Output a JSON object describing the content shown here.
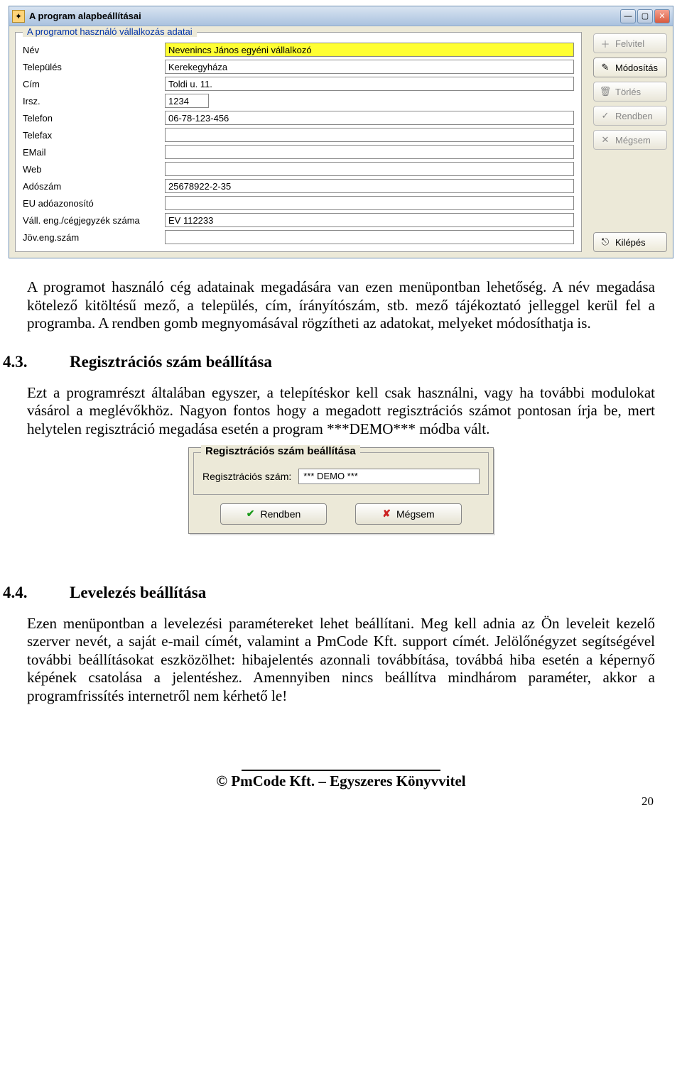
{
  "window1": {
    "title": "A program alapbeállításai",
    "groupbox_title": "A programot használó vállalkozás adatai",
    "fields": {
      "nev_label": "Név",
      "nev_value": "Nevenincs János egyéni vállalkozó",
      "telepules_label": "Település",
      "telepules_value": "Kerekegyháza",
      "cim_label": "Cím",
      "cim_value": "Toldi u. 11.",
      "irsz_label": "Irsz.",
      "irsz_value": "1234",
      "telefon_label": "Telefon",
      "telefon_value": "06-78-123-456",
      "telefax_label": "Telefax",
      "telefax_value": "",
      "email_label": "EMail",
      "email_value": "",
      "web_label": "Web",
      "web_value": "",
      "adoszam_label": "Adószám",
      "adoszam_value": "25678922-2-35",
      "euado_label": "EU adóazonosító",
      "euado_value": "",
      "vall_label": "Váll. eng./cégjegyzék száma",
      "vall_value": "EV 112233",
      "joveng_label": "Jöv.eng.szám",
      "joveng_value": ""
    },
    "buttons": {
      "felvitel": "Felvitel",
      "modositas": "Módosítás",
      "torles": "Törlés",
      "rendben": "Rendben",
      "megsem": "Mégsem",
      "kilepes": "Kilépés"
    }
  },
  "para1": "A programot használó cég adatainak megadására van ezen menüpontban lehetőség. A név megadása kötelező kitöltésű mező, a település, cím, írányítószám, stb. mező tájékoztató jelleggel kerül fel a programba. A rendben gomb megnyomásával rögzítheti az adatokat, melyeket módosíthatja is.",
  "heading1_num": "4.3.",
  "heading1_text": "Regisztrációs szám beállítása",
  "para2": "Ezt a programrészt általában egyszer, a telepítéskor kell csak használni, vagy ha további modulokat vásárol a meglévőkhöz. Nagyon fontos hogy a megadott regisztrációs számot pontosan írja be, mert helytelen regisztráció megadása esetén a program ***DEMO*** módba vált.",
  "window2": {
    "groupbox_title": "Regisztrációs szám beállítása",
    "label": "Regisztrációs szám:",
    "value": "*** DEMO ***",
    "rendben": "Rendben",
    "megsem": "Mégsem"
  },
  "heading2_num": "4.4.",
  "heading2_text": "Levelezés beállítása",
  "para3": "Ezen menüpontban a levelezési paramétereket lehet beállítani. Meg kell adnia az Ön leveleit kezelő szerver nevét, a saját e-mail címét, valamint a PmCode Kft. support címét. Jelölőnégyzet segítségével további beállításokat eszközölhet: hibajelentés azonnali továbbítása, továbbá hiba esetén a képernyő képének csatolása a jelentéshez. Amennyiben nincs beállítva mindhárom paraméter, akkor a programfrissítés internetről  nem kérhető le!",
  "footer_text": "© PmCode Kft. – Egyszeres Könyvvitel",
  "page_number": "20"
}
